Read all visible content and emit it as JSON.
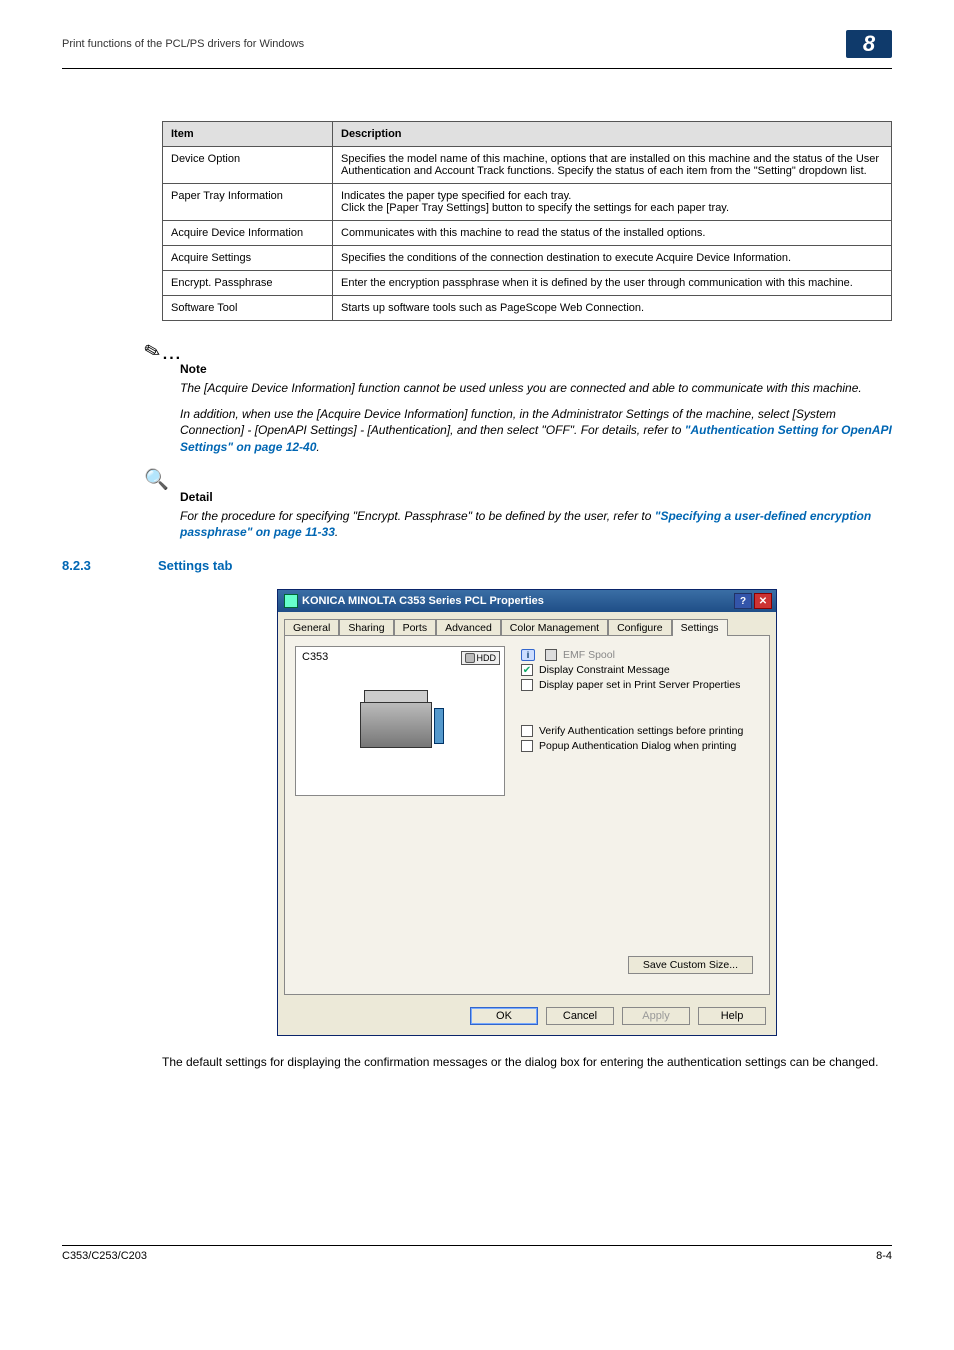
{
  "header": {
    "title": "Print functions of the PCL/PS drivers for Windows",
    "chapter": "8"
  },
  "table": {
    "headers": [
      "Item",
      "Description"
    ],
    "rows": [
      {
        "item": "Device Option",
        "desc": "Specifies the model name of this machine, options that are installed on this machine and the status of the User Authentication and Account Track functions. Specify the status of each item from the \"Setting\" dropdown list."
      },
      {
        "item": "Paper Tray Information",
        "desc": "Indicates the paper type specified for each tray.\nClick the [Paper Tray Settings] button to specify the settings for each paper tray."
      },
      {
        "item": "Acquire Device Information",
        "desc": "Communicates with this machine to read the status of the installed options."
      },
      {
        "item": "Acquire Settings",
        "desc": "Specifies the conditions of the connection destination to execute Acquire Device Information."
      },
      {
        "item": "Encrypt. Passphrase",
        "desc": "Enter the encryption passphrase when it is defined by the user through communication with this machine."
      },
      {
        "item": "Software Tool",
        "desc": "Starts up software tools such as PageScope Web Connection."
      }
    ]
  },
  "note": {
    "label": "Note",
    "p1": "The [Acquire Device Information] function cannot be used unless you are connected and able to communicate with this machine.",
    "p2a": "In addition, when use the [Acquire Device Information] function, in the Administrator Settings of the machine, select [System Connection] - [OpenAPI Settings] - [Authentication], and then select \"OFF\". For details, refer to ",
    "p2link": "\"Authentication Setting for OpenAPI Settings\" on page 12-40",
    "p2b": "."
  },
  "detail": {
    "label": "Detail",
    "p1a": "For the procedure for specifying \"Encrypt. Passphrase\" to be defined by the user, refer to ",
    "p1link": "\"Specifying a user-defined encryption passphrase\" on page 11-33",
    "p1b": "."
  },
  "section": {
    "num": "8.2.3",
    "title": "Settings tab"
  },
  "dialog": {
    "title": "KONICA MINOLTA C353 Series PCL Properties",
    "tabs": [
      "General",
      "Sharing",
      "Ports",
      "Advanced",
      "Color Management",
      "Configure",
      "Settings"
    ],
    "active_tab": "Settings",
    "model": "C353",
    "hdd": "HDD",
    "opts": {
      "emf": "EMF Spool",
      "constraint": "Display Constraint Message",
      "paperset": "Display paper set in Print Server Properties",
      "verify": "Verify Authentication settings before printing",
      "popup": "Popup Authentication Dialog when printing"
    },
    "save": "Save Custom Size...",
    "buttons": {
      "ok": "OK",
      "cancel": "Cancel",
      "apply": "Apply",
      "help": "Help"
    }
  },
  "body_after": "The default settings for displaying the confirmation messages or the dialog box for entering the authentication settings can be changed.",
  "footer": {
    "left": "C353/C253/C203",
    "right": "8-4"
  }
}
